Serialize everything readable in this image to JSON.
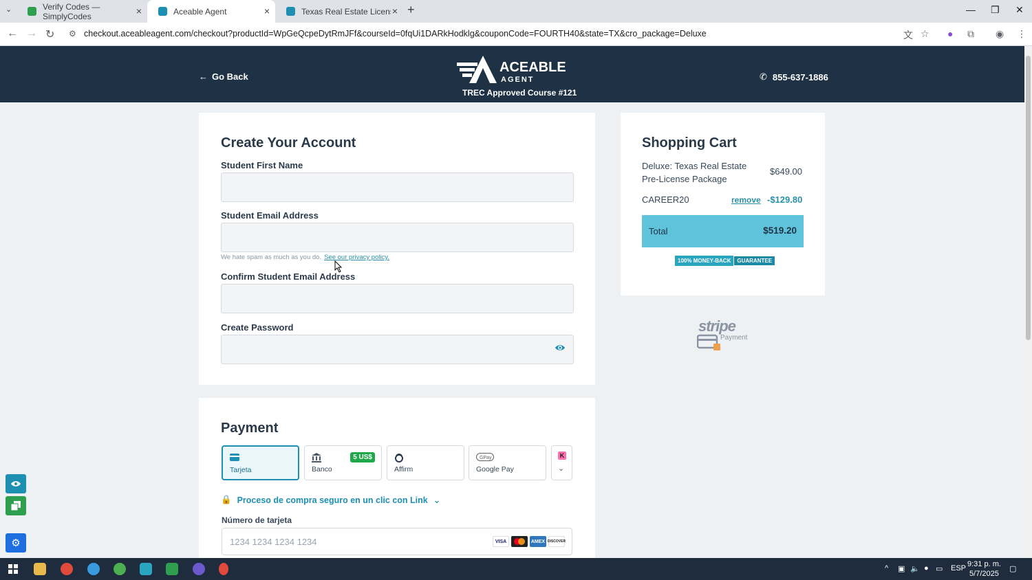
{
  "browser": {
    "tabs": [
      {
        "title": "Verify Codes — SimplyCodes",
        "active": false,
        "favicon_color": "#2e9e4f"
      },
      {
        "title": "Aceable Agent",
        "active": true,
        "favicon_color": "#1d8fb2"
      },
      {
        "title": "Texas Real Estate License Cours",
        "active": false,
        "favicon_color": "#1d8fb2"
      }
    ],
    "url": "checkout.aceableagent.com/checkout?productId=WpGeQcpeDytRmJFf&courseId=0fqUi1DARkHodklg&couponCode=FOURTH40&state=TX&cro_package=Deluxe"
  },
  "header": {
    "go_back": "Go Back",
    "brand_name": "ACEABLE",
    "brand_sub": "AGENT",
    "trec": "TREC Approved Course #121",
    "phone": "855-637-1886"
  },
  "account": {
    "title": "Create Your Account",
    "first_name_label": "Student First Name",
    "email_label": "Student Email Address",
    "spam_hint": "We hate spam as much as you do.",
    "privacy_link": "See our privacy policy.",
    "confirm_email_label": "Confirm Student Email Address",
    "password_label": "Create Password"
  },
  "cart": {
    "title": "Shopping Cart",
    "item_name": "Deluxe: Texas Real Estate Pre-License Package",
    "item_price": "$649.00",
    "coupon_code": "CAREER20",
    "remove_label": "remove",
    "discount": "-$129.80",
    "total_label": "Total",
    "total_value": "$519.20",
    "guarantee_a": "100% MONEY-BACK",
    "guarantee_b": "GUARANTEE",
    "stripe_word": "stripe",
    "stripe_payment": "Payment"
  },
  "payment": {
    "title": "Payment",
    "methods": [
      {
        "label": "Tarjeta",
        "active": true
      },
      {
        "label": "Banco",
        "badge": "5 US$"
      },
      {
        "label": "Affirm"
      },
      {
        "label": "Google Pay"
      }
    ],
    "link_text": "Proceso de compra seguro en un clic con Link",
    "card_number_label": "Número de tarjeta",
    "card_number_placeholder": "1234 1234 1234 1234",
    "brands": [
      "VISA",
      "MC",
      "AMEX",
      "DISCOVER"
    ]
  },
  "taskbar": {
    "lang": "ESP",
    "time": "9:31 p. m.",
    "date": "5/7/2025"
  },
  "colors": {
    "header_bg": "#1f3245",
    "accent": "#1d8fb2",
    "total_bg": "#5ec3db"
  }
}
